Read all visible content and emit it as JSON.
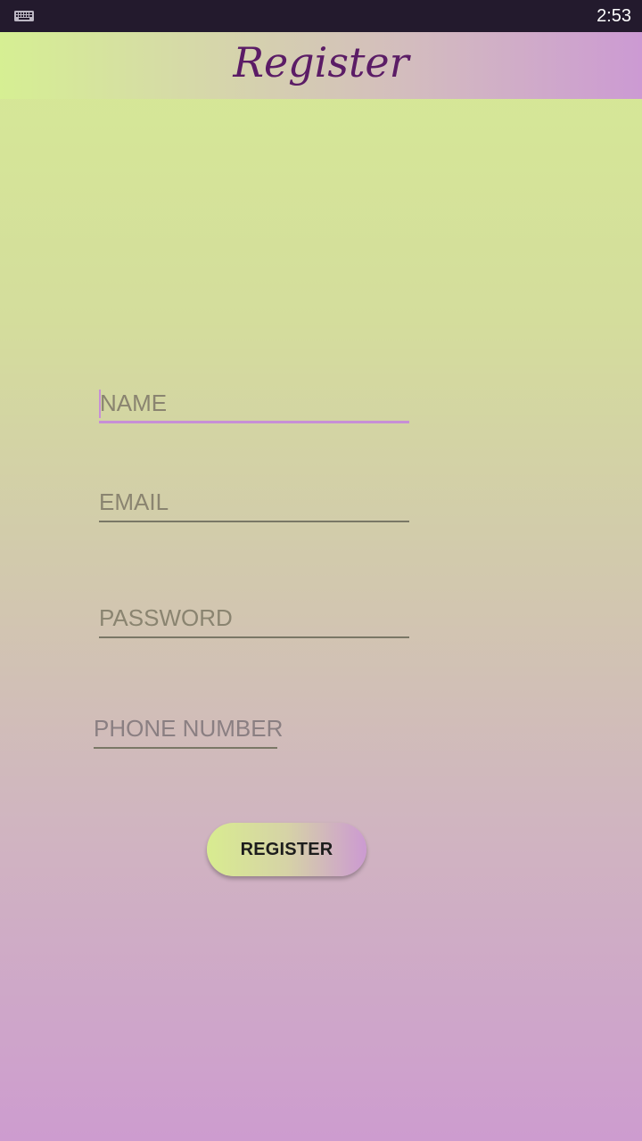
{
  "status_bar": {
    "time": "2:53",
    "icons": [
      "keyboard-icon"
    ]
  },
  "header": {
    "title": "Register"
  },
  "form": {
    "name_placeholder": "NAME",
    "email_placeholder": "EMAIL",
    "password_placeholder": "PASSWORD",
    "phone_placeholder": "PHONE NUMBER",
    "focused_field": "name",
    "submit_label": "REGISTER"
  },
  "colors": {
    "accent": "#c78fd6",
    "title": "#5b1c66",
    "gradient_top": "#d6eb95",
    "gradient_bottom": "#cd9ccf",
    "status_bar": "#231a2d"
  }
}
